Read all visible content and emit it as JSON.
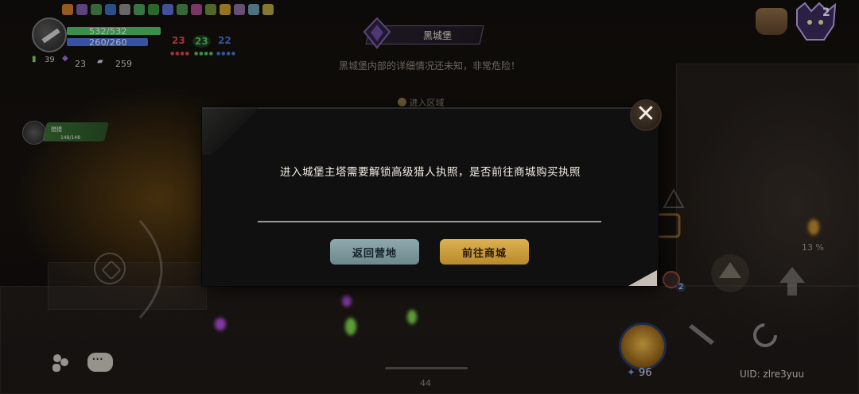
{
  "hud": {
    "hp_text": "532/532",
    "mp_text": "260/260",
    "level": "39",
    "crystals": "23",
    "scrolls": "259",
    "stats": [
      {
        "value": "23",
        "color": "#d04848"
      },
      {
        "value": "23",
        "color": "#4fbf63"
      },
      {
        "value": "22",
        "color": "#4a6ed8"
      }
    ],
    "party_member_name": "猎猎",
    "party_member_hp": "148/148"
  },
  "location": {
    "name": "黑城堡",
    "description": "黑城堡内部的详细情况还未知，非常危险！",
    "enter_label": "进入区域"
  },
  "dialog": {
    "message": "进入城堡主塔需要解锁高级猎人执照，是否前往商城购买执照",
    "back_label": "返回营地",
    "shop_label": "前往商城",
    "close_icon": "close-icon"
  },
  "right_hud": {
    "boss_count": "2",
    "percent": "13 %",
    "skill_points": "96",
    "potion_count": "2",
    "uid": "UID: zlre3yuu"
  },
  "footer": {
    "page_number": "44"
  },
  "colors": {
    "hp": "#4fbf63",
    "mp": "#4a6ed8",
    "primary_button": "#ddb052",
    "secondary_button": "#8fa9ad",
    "dialog_bg": "#101010"
  }
}
